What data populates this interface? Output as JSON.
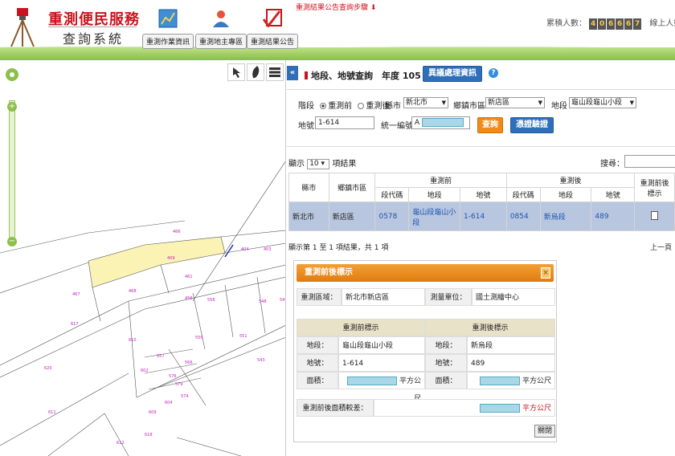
{
  "header": {
    "title": "重測便民服務",
    "subtitle": "查詢系統",
    "notice": "重測結果公告查詢步驟",
    "nav": [
      {
        "label": "重測作業資訊"
      },
      {
        "label": "重測地主專區"
      },
      {
        "label": "重測結果公告"
      }
    ],
    "counter_total_label": "累積人數：",
    "counter_total_digits": [
      "4",
      "0",
      "6",
      "6",
      "6",
      "7"
    ],
    "counter_online_label": "線上人數："
  },
  "panel": {
    "collapse_glyph": "«",
    "title": "地段、地號查詢",
    "year": "年度 105",
    "diff_button": "異議處理資訊",
    "help_glyph": "?",
    "form": {
      "stage_label": "階段",
      "stage_before": "重測前",
      "stage_after": "重測後",
      "city_label": "縣市",
      "city_value": "新北市",
      "district_label": "鄉鎮市區",
      "district_value": "新店區",
      "section_label": "地段",
      "section_value": "龜山段龜山小段",
      "lotno_label": "地號",
      "lotno_value": "1-614",
      "id_label": "統一編號",
      "id_value": "A",
      "query_button": "查詢",
      "verify_button": "憑證驗證"
    },
    "list": {
      "length_prefix": "顯示",
      "length_value": "10",
      "length_suffix": "項結果",
      "search_label": "搜尋：",
      "headers": {
        "city": "縣市",
        "district": "鄉鎮市區",
        "before": "重測前",
        "after": "重測後",
        "mark": "重測前後標示",
        "section_code": "段代碼",
        "section": "地段",
        "lotno": "地號"
      },
      "rows": [
        {
          "city": "新北市",
          "district": "新店區",
          "before_code": "0578",
          "before_section": "龜山段龜山小段",
          "before_lot": "1-614",
          "after_code": "0854",
          "after_section": "新烏段",
          "after_lot": "489"
        }
      ],
      "info": "顯示第 1 至 1 項結果，共 1 項",
      "pager": "上一頁"
    },
    "dialog": {
      "title": "重測前後標示",
      "close_glyph": "×",
      "area_label": "重測區域：",
      "area_value": "新北市新店區",
      "unit_label": "測量單位：",
      "unit_value": "國土測繪中心",
      "before_header": "重測前標示",
      "after_header": "重測後標示",
      "section_label": "地段：",
      "lot_label": "地號：",
      "size_label": "面積：",
      "before_section": "龜山段龜山小段",
      "before_lot": "1-614",
      "after_section": "新烏段",
      "after_lot": "489",
      "size_unit": "平方公尺",
      "diff_label": "重測前後面積較差：",
      "diff_unit": "平方公尺",
      "close_button": "關閉"
    }
  },
  "map": {
    "parcels": [
      {
        "label": "466"
      },
      {
        "label": "409"
      },
      {
        "label": "404"
      },
      {
        "label": "403"
      },
      {
        "label": "468"
      },
      {
        "label": "461"
      },
      {
        "label": "467"
      },
      {
        "label": "456"
      },
      {
        "label": "556"
      },
      {
        "label": "617"
      },
      {
        "label": "610"
      },
      {
        "label": "557"
      },
      {
        "label": "550"
      },
      {
        "label": "551"
      },
      {
        "label": "548"
      },
      {
        "label": "543"
      },
      {
        "label": "545"
      },
      {
        "label": "620"
      },
      {
        "label": "602"
      },
      {
        "label": "576"
      },
      {
        "label": "579"
      },
      {
        "label": "574"
      },
      {
        "label": "611"
      },
      {
        "label": "612"
      },
      {
        "label": "618"
      },
      {
        "label": "609"
      },
      {
        "label": "604"
      },
      {
        "label": "566"
      }
    ]
  }
}
